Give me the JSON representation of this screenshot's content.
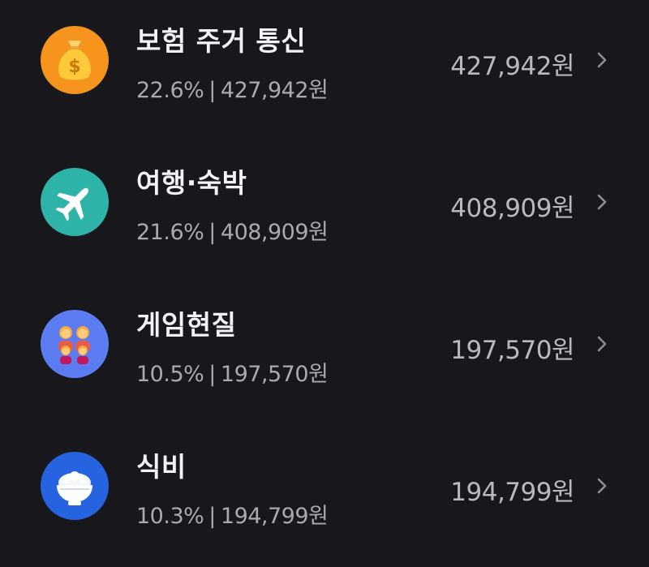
{
  "categories": [
    {
      "title": "보험 주거 통신",
      "percent": "22.6%",
      "detail_amount": "427,942원",
      "amount": "427,942원",
      "icon": "money-bag-icon",
      "icon_bg": "#f7941d"
    },
    {
      "title": "여행·숙박",
      "percent": "21.6%",
      "detail_amount": "408,909원",
      "amount": "408,909원",
      "icon": "airplane-icon",
      "icon_bg": "#2eb3a8"
    },
    {
      "title": "게임현질",
      "percent": "10.5%",
      "detail_amount": "197,570원",
      "amount": "197,570원",
      "icon": "family-icon",
      "icon_bg": "#5c7cf2"
    },
    {
      "title": "식비",
      "percent": "10.3%",
      "detail_amount": "194,799원",
      "amount": "194,799원",
      "icon": "rice-bowl-icon",
      "icon_bg": "#2563e0"
    }
  ],
  "separator": "|"
}
